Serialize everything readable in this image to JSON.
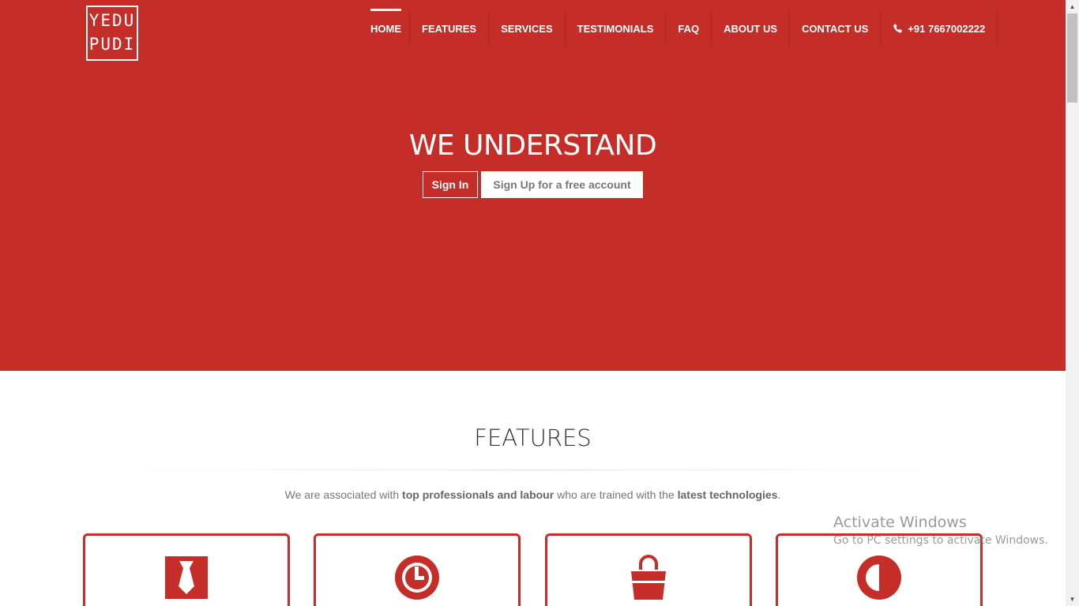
{
  "logo": {
    "line1": "YEDU",
    "line2": "PUDI"
  },
  "nav": {
    "items": [
      {
        "label": "HOME"
      },
      {
        "label": "FEATURES"
      },
      {
        "label": "SERVICES"
      },
      {
        "label": "TESTIMONIALS"
      },
      {
        "label": "FAQ"
      },
      {
        "label": "ABOUT US"
      },
      {
        "label": "CONTACT US"
      },
      {
        "label": "+91 7667002222",
        "icon": "phone-icon"
      }
    ],
    "active": "HOME"
  },
  "hero": {
    "title": "WE UNDERSTAND",
    "signin_label": "Sign In",
    "signup_label": "Sign Up for a free account"
  },
  "features": {
    "title": "FEATURES",
    "subtitle_parts": [
      "We are associated with ",
      "top professionals and labour",
      " who are trained with the ",
      "latest technologies",
      "."
    ],
    "cards": [
      {
        "icon": "tie-icon"
      },
      {
        "icon": "clock-icon"
      },
      {
        "icon": "shopping-bag-icon"
      },
      {
        "icon": "contrast-icon"
      }
    ]
  },
  "watermark": {
    "title": "Activate Windows",
    "subtitle": "Go to PC settings to activate Windows."
  },
  "colors": {
    "brand_red": "#c52d29",
    "white": "#ffffff",
    "text_gray": "#777777"
  }
}
